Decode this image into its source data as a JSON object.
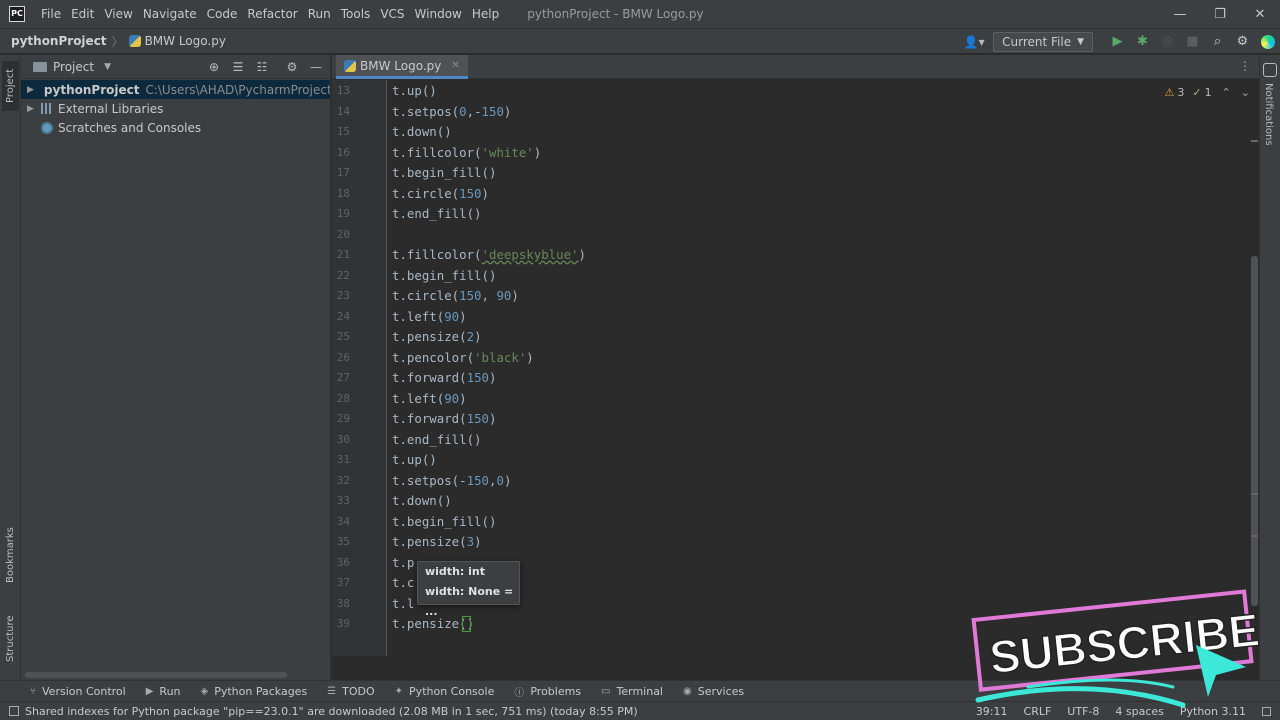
{
  "app": {
    "logo_text": "PC",
    "menu": [
      "File",
      "Edit",
      "View",
      "Navigate",
      "Code",
      "Refactor",
      "Run",
      "Tools",
      "VCS",
      "Window",
      "Help"
    ],
    "window_title": "pythonProject - BMW Logo.py"
  },
  "window_controls": {
    "minimize": "—",
    "restore": "❐",
    "close": "✕"
  },
  "navbar": {
    "project": "pythonProject",
    "file": "BMW Logo.py",
    "run_config": "Current File"
  },
  "left_strip": {
    "project": "Project",
    "bookmarks": "Bookmarks",
    "structure": "Structure"
  },
  "right_strip": {
    "notifications": "Notifications"
  },
  "project_panel": {
    "title": "Project",
    "tree": [
      {
        "label": "pythonProject",
        "path": "C:\\Users\\AHAD\\PycharmProjects\\pyth"
      },
      {
        "label": "External Libraries"
      },
      {
        "label": "Scratches and Consoles"
      }
    ]
  },
  "editor": {
    "tab": "BMW Logo.py",
    "inspection": {
      "warnings": "3",
      "weak_warnings": "1"
    },
    "lines": [
      {
        "n": "13",
        "code": "t.up()"
      },
      {
        "n": "14",
        "code": "t.setpos(0,-150)"
      },
      {
        "n": "15",
        "code": "t.down()"
      },
      {
        "n": "16",
        "code": "t.fillcolor('white')"
      },
      {
        "n": "17",
        "code": "t.begin_fill()"
      },
      {
        "n": "18",
        "code": "t.circle(150)"
      },
      {
        "n": "19",
        "code": "t.end_fill()"
      },
      {
        "n": "20",
        "code": ""
      },
      {
        "n": "21",
        "code": "t.fillcolor('deepskyblue')"
      },
      {
        "n": "22",
        "code": "t.begin_fill()"
      },
      {
        "n": "23",
        "code": "t.circle(150, 90)"
      },
      {
        "n": "24",
        "code": "t.left(90)"
      },
      {
        "n": "25",
        "code": "t.pensize(2)"
      },
      {
        "n": "26",
        "code": "t.pencolor('black')"
      },
      {
        "n": "27",
        "code": "t.forward(150)"
      },
      {
        "n": "28",
        "code": "t.left(90)"
      },
      {
        "n": "29",
        "code": "t.forward(150)"
      },
      {
        "n": "30",
        "code": "t.end_fill()"
      },
      {
        "n": "31",
        "code": "t.up()"
      },
      {
        "n": "32",
        "code": "t.setpos(-150,0)"
      },
      {
        "n": "33",
        "code": "t.down()"
      },
      {
        "n": "34",
        "code": "t.begin_fill()"
      },
      {
        "n": "35",
        "code": "t.pensize(3)"
      },
      {
        "n": "36",
        "code": "t.p"
      },
      {
        "n": "37",
        "code": "t.c"
      },
      {
        "n": "38",
        "code": "t.l"
      },
      {
        "n": "39",
        "code": "t.pensize()"
      }
    ],
    "param_hint": [
      "width: int",
      "width: None = ..."
    ]
  },
  "tool_windows": [
    "Version Control",
    "Run",
    "Python Packages",
    "TODO",
    "Python Console",
    "Problems",
    "Terminal",
    "Services"
  ],
  "status_bar": {
    "message": "Shared indexes for Python package \"pip==23.0.1\" are downloaded (2.08 MB in 1 sec, 751 ms) (today 8:55 PM)",
    "position": "39:11",
    "line_sep": "CRLF",
    "encoding": "UTF-8",
    "indent": "4 spaces",
    "interpreter": "Python 3.11"
  },
  "overlay": {
    "subscribe": "SUBSCRIBE"
  },
  "colors": {
    "keyword_number": "#6897bb",
    "string": "#6a8759",
    "text": "#a9b7c6",
    "subscribe_border": "#e07ad6",
    "subscribe_arrow": "#3ce8d8"
  }
}
